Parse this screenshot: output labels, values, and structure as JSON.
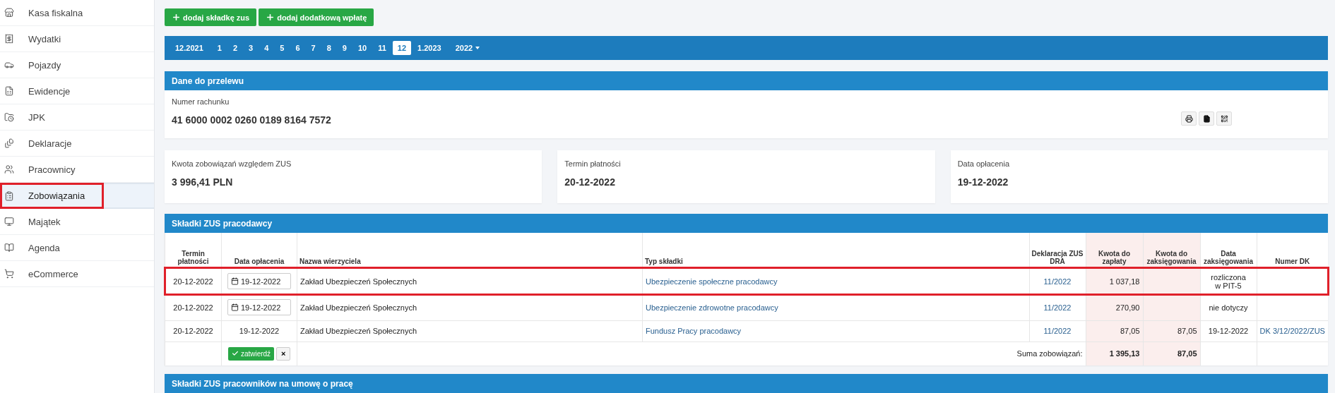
{
  "sidebar": {
    "items": [
      {
        "label": "Kasa fiskalna",
        "selected": false,
        "highlighted": false
      },
      {
        "label": "Wydatki",
        "selected": false,
        "highlighted": false
      },
      {
        "label": "Pojazdy",
        "selected": false,
        "highlighted": false
      },
      {
        "label": "Ewidencje",
        "selected": false,
        "highlighted": false
      },
      {
        "label": "JPK",
        "selected": false,
        "highlighted": false
      },
      {
        "label": "Deklaracje",
        "selected": false,
        "highlighted": false
      },
      {
        "label": "Pracownicy",
        "selected": false,
        "highlighted": false
      },
      {
        "label": "Zobowiązania",
        "selected": true,
        "highlighted": true
      },
      {
        "label": "Majątek",
        "selected": false,
        "highlighted": false
      },
      {
        "label": "Agenda",
        "selected": false,
        "highlighted": false
      },
      {
        "label": "eCommerce",
        "selected": false,
        "highlighted": false
      }
    ]
  },
  "toolbar": {
    "buttons": [
      {
        "label": "dodaj składkę zus"
      },
      {
        "label": "dodaj dodatkową wpłatę"
      }
    ]
  },
  "month_nav": {
    "items": [
      {
        "label": "12.2021",
        "selected": false
      },
      {
        "label": "1",
        "selected": false
      },
      {
        "label": "2",
        "selected": false
      },
      {
        "label": "3",
        "selected": false
      },
      {
        "label": "4",
        "selected": false
      },
      {
        "label": "5",
        "selected": false
      },
      {
        "label": "6",
        "selected": false
      },
      {
        "label": "7",
        "selected": false
      },
      {
        "label": "8",
        "selected": false
      },
      {
        "label": "9",
        "selected": false
      },
      {
        "label": "10",
        "selected": false
      },
      {
        "label": "11",
        "selected": false
      },
      {
        "label": "12",
        "selected": true
      },
      {
        "label": "1.2023",
        "selected": false
      }
    ],
    "year": "2022"
  },
  "transfer": {
    "title": "Dane do przelewu",
    "account_label": "Numer rachunku",
    "account_number": "41 6000 0002 0260 0189 8164 7572"
  },
  "summary_cards": [
    {
      "label": "Kwota zobowiązań względem ZUS",
      "value": "3 996,41 PLN"
    },
    {
      "label": "Termin płatności",
      "value": "20-12-2022"
    },
    {
      "label": "Data opłacenia",
      "value": "19-12-2022"
    }
  ],
  "employer_table": {
    "title": "Składki ZUS pracodawcy",
    "columns": [
      {
        "label": "Termin płatności",
        "tinted": false
      },
      {
        "label": "Data opłacenia",
        "tinted": false
      },
      {
        "label": "Nazwa wierzyciela",
        "tinted": false
      },
      {
        "label": "Typ składki",
        "tinted": false
      },
      {
        "label": "Deklaracja ZUS DRA",
        "tinted": false
      },
      {
        "label": "Kwota do zapłaty",
        "tinted": true
      },
      {
        "label": "Kwota do zaksięgowania",
        "tinted": true
      },
      {
        "label": "Data zaksięgowania",
        "tinted": false
      },
      {
        "label": "Numer DK",
        "tinted": false
      }
    ],
    "rows": [
      {
        "due": "20-12-2022",
        "paid": {
          "kind": "input",
          "value": "19-12-2022"
        },
        "creditor": "Zakład Ubezpieczeń Społecznych",
        "type": "Ubezpieczenie społeczne pracodawcy",
        "declaration": "11/2022",
        "to_pay": "1 037,18",
        "to_book": "",
        "booked": "rozliczona w PIT-5",
        "dk": "",
        "highlighted": true
      },
      {
        "due": "20-12-2022",
        "paid": {
          "kind": "input",
          "value": "19-12-2022"
        },
        "creditor": "Zakład Ubezpieczeń Społecznych",
        "type": "Ubezpieczenie zdrowotne pracodawcy",
        "declaration": "11/2022",
        "to_pay": "270,90",
        "to_book": "",
        "booked": "nie dotyczy",
        "dk": "",
        "highlighted": false
      },
      {
        "due": "20-12-2022",
        "paid": {
          "kind": "text",
          "value": "19-12-2022"
        },
        "creditor": "Zakład Ubezpieczeń Społecznych",
        "type": "Fundusz Pracy pracodawcy",
        "declaration": "11/2022",
        "to_pay": "87,05",
        "to_book": "87,05",
        "booked": "19-12-2022",
        "dk": "DK 3/12/2022/ZUS",
        "highlighted": false
      }
    ],
    "footer": {
      "confirm_label": "zatwierdź",
      "cancel_label": "×",
      "total_label": "Suma zobowiązań:",
      "total_to_pay": "1 395,13",
      "total_to_book": "87,05"
    }
  },
  "next_section": {
    "title": "Składki ZUS pracowników na umowę o pracę"
  }
}
